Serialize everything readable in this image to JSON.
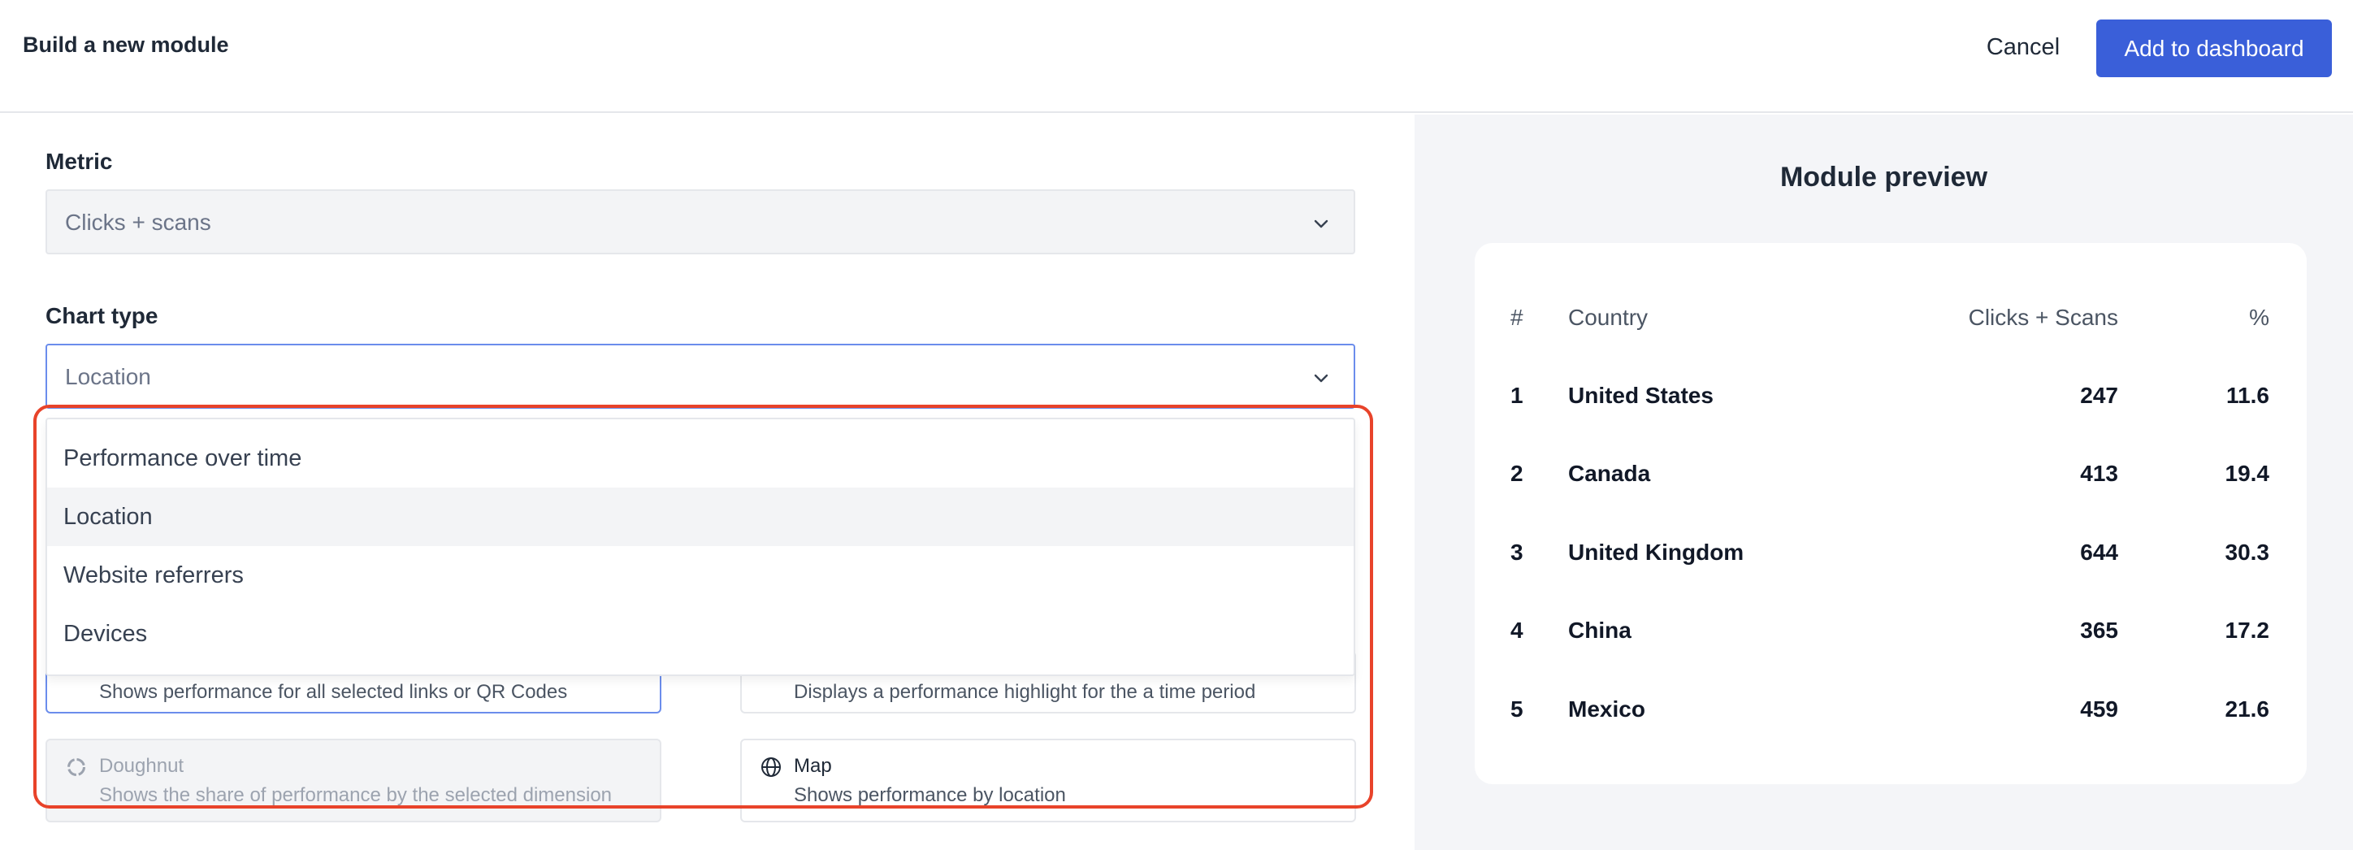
{
  "header": {
    "title": "Build a new module",
    "cancel_label": "Cancel",
    "add_label": "Add to dashboard",
    "accent_color": "#3a5fd9"
  },
  "metric": {
    "label": "Metric",
    "value": "Clicks + scans"
  },
  "chart_type": {
    "label": "Chart type",
    "value": "Location",
    "options": [
      "Performance over time",
      "Location",
      "Website referrers",
      "Devices"
    ],
    "selected_index": 1,
    "highlight_color": "#e8432a"
  },
  "cards": [
    {
      "title": "",
      "desc": "Shows performance for all selected links or QR Codes"
    },
    {
      "title": "",
      "desc": "Displays a performance highlight for the a time period"
    },
    {
      "title": "Doughnut",
      "desc": "Shows the share of performance by the selected dimension",
      "icon": "doughnut-icon",
      "disabled": true
    },
    {
      "title": "Map",
      "desc": "Shows performance by location",
      "icon": "globe-icon"
    }
  ],
  "preview": {
    "title": "Module preview",
    "columns": [
      "#",
      "Country",
      "Clicks + Scans",
      "%"
    ],
    "rows": [
      {
        "rank": "1",
        "country": "United States",
        "clicks": "247",
        "pct": "11.6"
      },
      {
        "rank": "2",
        "country": "Canada",
        "clicks": "413",
        "pct": "19.4"
      },
      {
        "rank": "3",
        "country": "United Kingdom",
        "clicks": "644",
        "pct": "30.3"
      },
      {
        "rank": "4",
        "country": "China",
        "clicks": "365",
        "pct": "17.2"
      },
      {
        "rank": "5",
        "country": "Mexico",
        "clicks": "459",
        "pct": "21.6"
      }
    ]
  }
}
